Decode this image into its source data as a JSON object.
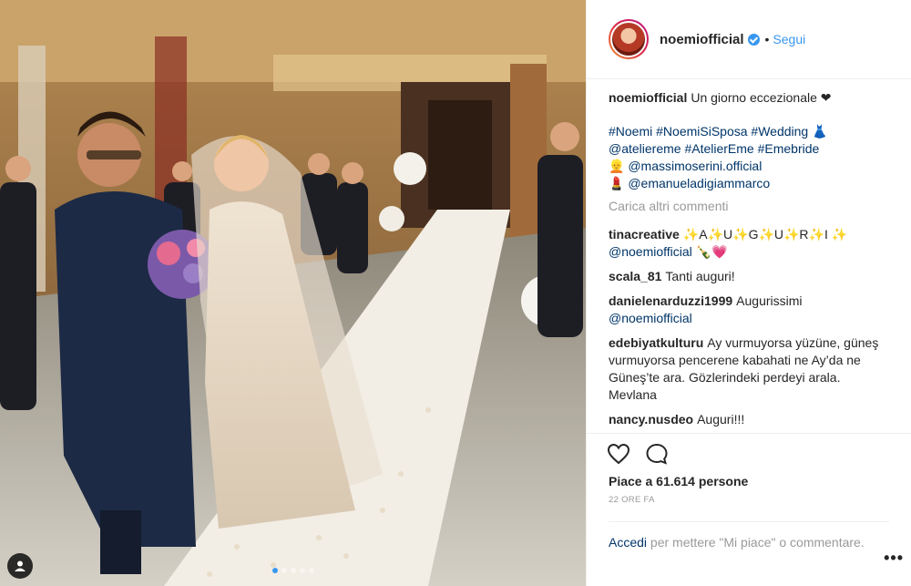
{
  "post": {
    "username": "noemiofficial",
    "follow_label": "Segui",
    "bullet": "•"
  },
  "caption": {
    "username": "noemiofficial",
    "text": "Un giorno eccezionale ❤",
    "tags_line1": "#Noemi #NoemiSiSposa #Wedding 👗",
    "tags_line2": "@ateliereme #AtelierEme #Emebride",
    "tags_line3_mention": "@massimoserini.official",
    "tags_line4_mention": "@emanueladigiammarco",
    "emoji_line3": "👱",
    "emoji_line4": "💄"
  },
  "load_more_label": "Carica altri commenti",
  "comments": [
    {
      "user": "tinacreative",
      "text": "✨A✨U✨G✨U✨R✨I ✨",
      "mention": "@noemiofficial",
      "tail": "🍾💗"
    },
    {
      "user": "scala_81",
      "text": "Tanti auguri!"
    },
    {
      "user": "danielenarduzzi1999",
      "text": "Augurissimi",
      "mention": "@noemiofficial"
    },
    {
      "user": "edebiyatkulturu",
      "text": "Ay vurmuyorsa yüzüne, güneş vurmuyorsa pencerene kabahati ne Ay’da ne Güneş’te ara. Gözlerindeki perdeyi arala. Mevlana"
    },
    {
      "user": "nancy.nusdeo",
      "text": "Auguri!!!"
    }
  ],
  "likes_text": "Piace a 61.614 persone",
  "time_text": "22 ORE FA",
  "login_link": "Accedi",
  "login_text": "per mettere \"Mi piace\" o commentare.",
  "more_label": "•••",
  "icons": {
    "like": "heart-icon",
    "comment": "comment-icon",
    "tag": "person-tag-icon"
  },
  "colors": {
    "link": "#003569",
    "follow": "#3897f0",
    "muted": "#999999"
  }
}
